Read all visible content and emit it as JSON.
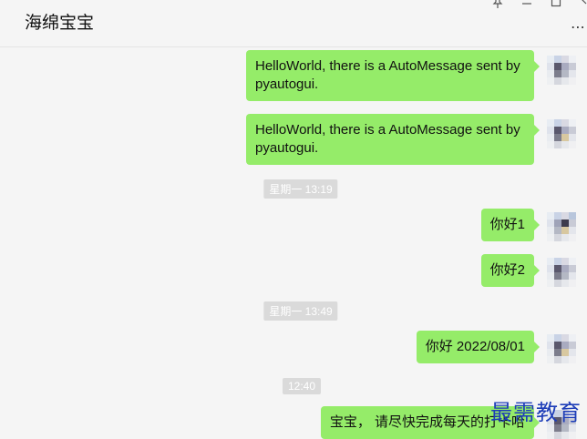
{
  "header": {
    "title": "海绵宝宝",
    "pin_icon": "pin-icon",
    "minimize_icon": "minimize-icon",
    "maximize_icon": "maximize-icon",
    "close_icon": "close-icon",
    "more_icon": "more-icon"
  },
  "messages": [
    {
      "text": "HelloWorld, there is a AutoMessage sent by pyautogui."
    },
    {
      "text": "HelloWorld, there is a AutoMessage sent by pyautogui."
    },
    {
      "time": "星期一 13:19"
    },
    {
      "text": "你好1"
    },
    {
      "text": "你好2"
    },
    {
      "time": "星期一 13:49"
    },
    {
      "text": "你好 2022/08/01"
    },
    {
      "time": "12:40"
    },
    {
      "text": "宝宝， 请尽快完成每天的打卡哈"
    }
  ],
  "watermark": "最需教育",
  "colors": {
    "bubble": "#95ec69",
    "background": "#f5f5f5",
    "timestamp_bg": "#dadada"
  }
}
